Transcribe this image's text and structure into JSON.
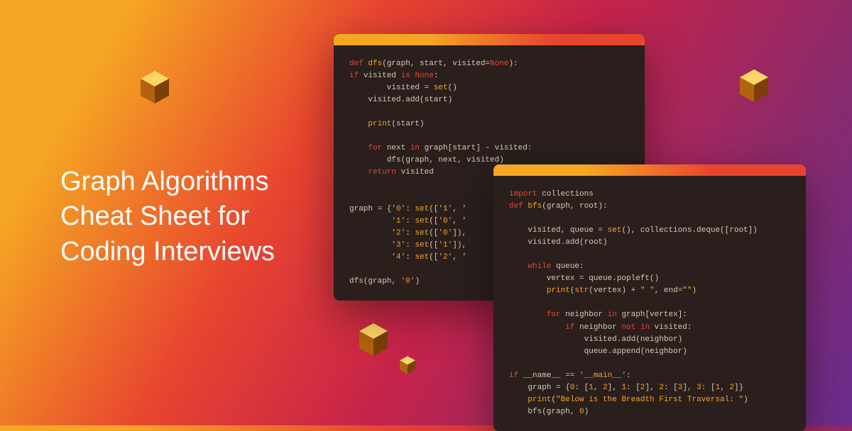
{
  "title": "Graph Algorithms\nCheat Sheet for\nCoding Interviews",
  "code1": {
    "lines": [
      [
        {
          "t": "def ",
          "c": "kw"
        },
        {
          "t": "dfs",
          "c": "fn"
        },
        {
          "t": "(graph, start, visited="
        },
        {
          "t": "None",
          "c": "kw"
        },
        {
          "t": "):"
        }
      ],
      [
        {
          "t": "if ",
          "c": "kw"
        },
        {
          "t": "visited "
        },
        {
          "t": "is ",
          "c": "kw"
        },
        {
          "t": "None",
          "c": "kw"
        },
        {
          "t": ":"
        }
      ],
      [
        {
          "t": "        visited = "
        },
        {
          "t": "set",
          "c": "fn"
        },
        {
          "t": "()"
        }
      ],
      [
        {
          "t": "    visited.add(start)"
        }
      ],
      [
        {
          "t": ""
        }
      ],
      [
        {
          "t": "    "
        },
        {
          "t": "print",
          "c": "fn"
        },
        {
          "t": "(start)"
        }
      ],
      [
        {
          "t": ""
        }
      ],
      [
        {
          "t": "    "
        },
        {
          "t": "for ",
          "c": "kw"
        },
        {
          "t": "next "
        },
        {
          "t": "in ",
          "c": "kw"
        },
        {
          "t": "graph[start] - visited:"
        }
      ],
      [
        {
          "t": "        dfs(graph, next, visited)"
        }
      ],
      [
        {
          "t": "    "
        },
        {
          "t": "return ",
          "c": "kw"
        },
        {
          "t": "visited"
        }
      ],
      [
        {
          "t": ""
        }
      ],
      [
        {
          "t": ""
        }
      ],
      [
        {
          "t": "graph = {"
        },
        {
          "t": "'0'",
          "c": "str"
        },
        {
          "t": ": "
        },
        {
          "t": "set",
          "c": "fn"
        },
        {
          "t": "(["
        },
        {
          "t": "'1'",
          "c": "str"
        },
        {
          "t": ", "
        },
        {
          "t": "'"
        }
      ],
      [
        {
          "t": "         "
        },
        {
          "t": "'1'",
          "c": "str"
        },
        {
          "t": ": "
        },
        {
          "t": "set",
          "c": "fn"
        },
        {
          "t": "(["
        },
        {
          "t": "'0'",
          "c": "str"
        },
        {
          "t": ", "
        },
        {
          "t": "'"
        }
      ],
      [
        {
          "t": "         "
        },
        {
          "t": "'2'",
          "c": "str"
        },
        {
          "t": ": "
        },
        {
          "t": "set",
          "c": "fn"
        },
        {
          "t": "(["
        },
        {
          "t": "'0'",
          "c": "str"
        },
        {
          "t": "]),"
        }
      ],
      [
        {
          "t": "         "
        },
        {
          "t": "'3'",
          "c": "str"
        },
        {
          "t": ": "
        },
        {
          "t": "set",
          "c": "fn"
        },
        {
          "t": "(["
        },
        {
          "t": "'1'",
          "c": "str"
        },
        {
          "t": "]),"
        }
      ],
      [
        {
          "t": "         "
        },
        {
          "t": "'4'",
          "c": "str"
        },
        {
          "t": ": "
        },
        {
          "t": "set",
          "c": "fn"
        },
        {
          "t": "(["
        },
        {
          "t": "'2'",
          "c": "str"
        },
        {
          "t": ", "
        },
        {
          "t": "'"
        }
      ],
      [
        {
          "t": ""
        }
      ],
      [
        {
          "t": "dfs(graph, "
        },
        {
          "t": "'0'",
          "c": "str"
        },
        {
          "t": ")"
        }
      ]
    ]
  },
  "code2": {
    "lines": [
      [
        {
          "t": "import ",
          "c": "kw"
        },
        {
          "t": "collections"
        }
      ],
      [
        {
          "t": "def ",
          "c": "kw"
        },
        {
          "t": "bfs",
          "c": "fn"
        },
        {
          "t": "(graph, root):"
        }
      ],
      [
        {
          "t": ""
        }
      ],
      [
        {
          "t": "    visited, queue = "
        },
        {
          "t": "set",
          "c": "fn"
        },
        {
          "t": "(), collections.deque([root])"
        }
      ],
      [
        {
          "t": "    visited.add(root)"
        }
      ],
      [
        {
          "t": ""
        }
      ],
      [
        {
          "t": "    "
        },
        {
          "t": "while ",
          "c": "kw"
        },
        {
          "t": "queue:"
        }
      ],
      [
        {
          "t": "        vertex = queue.popleft()"
        }
      ],
      [
        {
          "t": "        "
        },
        {
          "t": "print",
          "c": "fn"
        },
        {
          "t": "("
        },
        {
          "t": "str",
          "c": "fn"
        },
        {
          "t": "(vertex) + "
        },
        {
          "t": "\" \"",
          "c": "str"
        },
        {
          "t": ", end="
        },
        {
          "t": "\"\"",
          "c": "str"
        },
        {
          "t": ")"
        }
      ],
      [
        {
          "t": ""
        }
      ],
      [
        {
          "t": "        "
        },
        {
          "t": "for ",
          "c": "kw"
        },
        {
          "t": "neighbor "
        },
        {
          "t": "in ",
          "c": "kw"
        },
        {
          "t": "graph[vertex]:"
        }
      ],
      [
        {
          "t": "            "
        },
        {
          "t": "if ",
          "c": "kw"
        },
        {
          "t": "neighbor "
        },
        {
          "t": "not in ",
          "c": "kw"
        },
        {
          "t": "visited:"
        }
      ],
      [
        {
          "t": "                visited.add(neighbor)"
        }
      ],
      [
        {
          "t": "                queue.append(neighbor)"
        }
      ],
      [
        {
          "t": ""
        }
      ],
      [
        {
          "t": "if ",
          "c": "kw"
        },
        {
          "t": "__name__ == "
        },
        {
          "t": "'__main__'",
          "c": "str"
        },
        {
          "t": ":"
        }
      ],
      [
        {
          "t": "    graph = {"
        },
        {
          "t": "0",
          "c": "num"
        },
        {
          "t": ": ["
        },
        {
          "t": "1",
          "c": "num"
        },
        {
          "t": ", "
        },
        {
          "t": "2",
          "c": "num"
        },
        {
          "t": "], "
        },
        {
          "t": "1",
          "c": "num"
        },
        {
          "t": ": ["
        },
        {
          "t": "2",
          "c": "num"
        },
        {
          "t": "], "
        },
        {
          "t": "2",
          "c": "num"
        },
        {
          "t": ": ["
        },
        {
          "t": "3",
          "c": "num"
        },
        {
          "t": "], "
        },
        {
          "t": "3",
          "c": "num"
        },
        {
          "t": ": ["
        },
        {
          "t": "1",
          "c": "num"
        },
        {
          "t": ", "
        },
        {
          "t": "2",
          "c": "num"
        },
        {
          "t": "]}"
        }
      ],
      [
        {
          "t": "    "
        },
        {
          "t": "print",
          "c": "fn"
        },
        {
          "t": "("
        },
        {
          "t": "\"Below is the Breadth First Traversal: \"",
          "c": "str"
        },
        {
          "t": ")"
        }
      ],
      [
        {
          "t": "    bfs(graph, "
        },
        {
          "t": "0",
          "c": "num"
        },
        {
          "t": ")"
        }
      ]
    ]
  }
}
